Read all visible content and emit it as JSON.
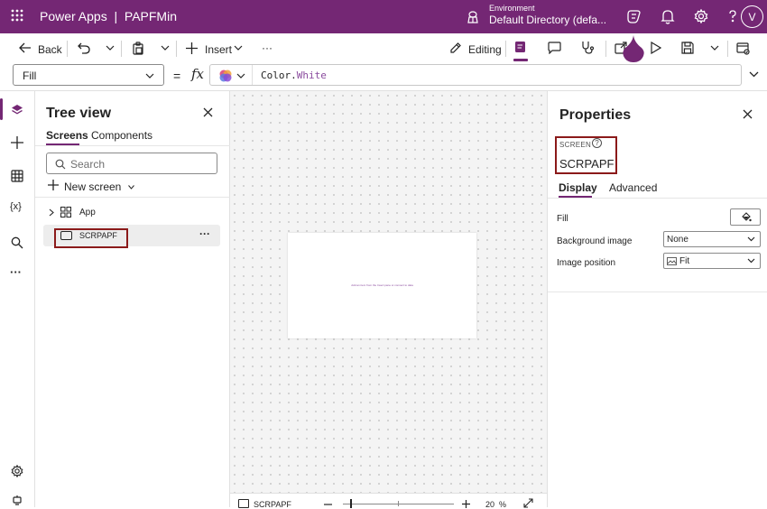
{
  "header": {
    "app_title": "Power Apps  |  PAPFMin",
    "environment_label": "Environment",
    "environment_name": "Default Directory (defa...",
    "user_initial": "V",
    "brand_color": "#742774"
  },
  "toolbar": {
    "back_label": "Back",
    "insert_label": "Insert",
    "more_label": "···",
    "editing_label": "Editing"
  },
  "formula_bar": {
    "property": "Fill",
    "fx_label": "fx",
    "formula": "Color.White"
  },
  "rail": {
    "variables_label": "{x}",
    "more_label": "···"
  },
  "tree_view": {
    "title": "Tree view",
    "tabs": [
      "Screens",
      "Components"
    ],
    "search_placeholder": "Search",
    "new_screen_label": "New screen",
    "items": [
      {
        "label": "App"
      },
      {
        "label": "SCRPAPF",
        "selected": true
      }
    ]
  },
  "canvas": {
    "screen_message": "Add an item from the Insert pane or connect to data",
    "footer_screen": "SCRPAPF",
    "zoom": "20  %"
  },
  "properties": {
    "title": "Properties",
    "type_label": "SCREEN",
    "help_label": "?",
    "screen_name": "SCRPAPF",
    "tabs": [
      "Display",
      "Advanced"
    ],
    "fields": [
      {
        "label": "Fill"
      },
      {
        "label": "Background image",
        "value": "None"
      },
      {
        "label": "Image position",
        "value": "Fit"
      }
    ]
  }
}
